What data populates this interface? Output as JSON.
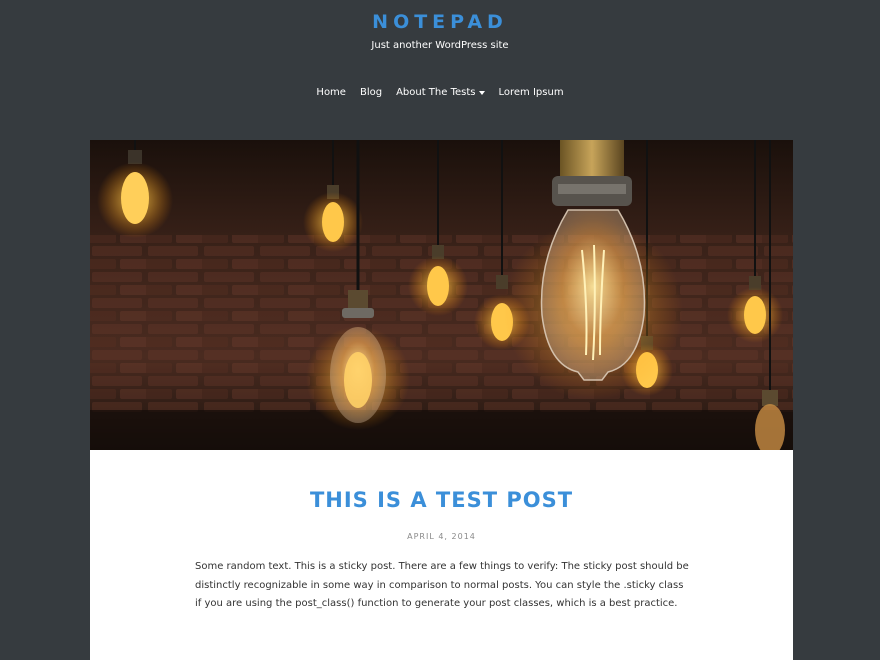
{
  "site": {
    "title": "NOTEPAD",
    "description": "Just another WordPress site"
  },
  "nav": {
    "items": [
      {
        "label": "Home"
      },
      {
        "label": "Blog"
      },
      {
        "label": "About The Tests",
        "has_dropdown": true
      },
      {
        "label": "Lorem Ipsum"
      }
    ]
  },
  "post": {
    "title": "THIS IS A TEST POST",
    "date": "APRIL 4, 2014",
    "excerpt": "Some random text. This is a sticky post. There are a few things to verify: The sticky post should be distinctly recognizable in some way in comparison to normal posts. You can style the .sticky class if you are using the post_class() function to generate your post classes, which is a best practice."
  },
  "colors": {
    "background": "#363b3f",
    "accent": "#3b8fd9",
    "card": "#ffffff"
  }
}
